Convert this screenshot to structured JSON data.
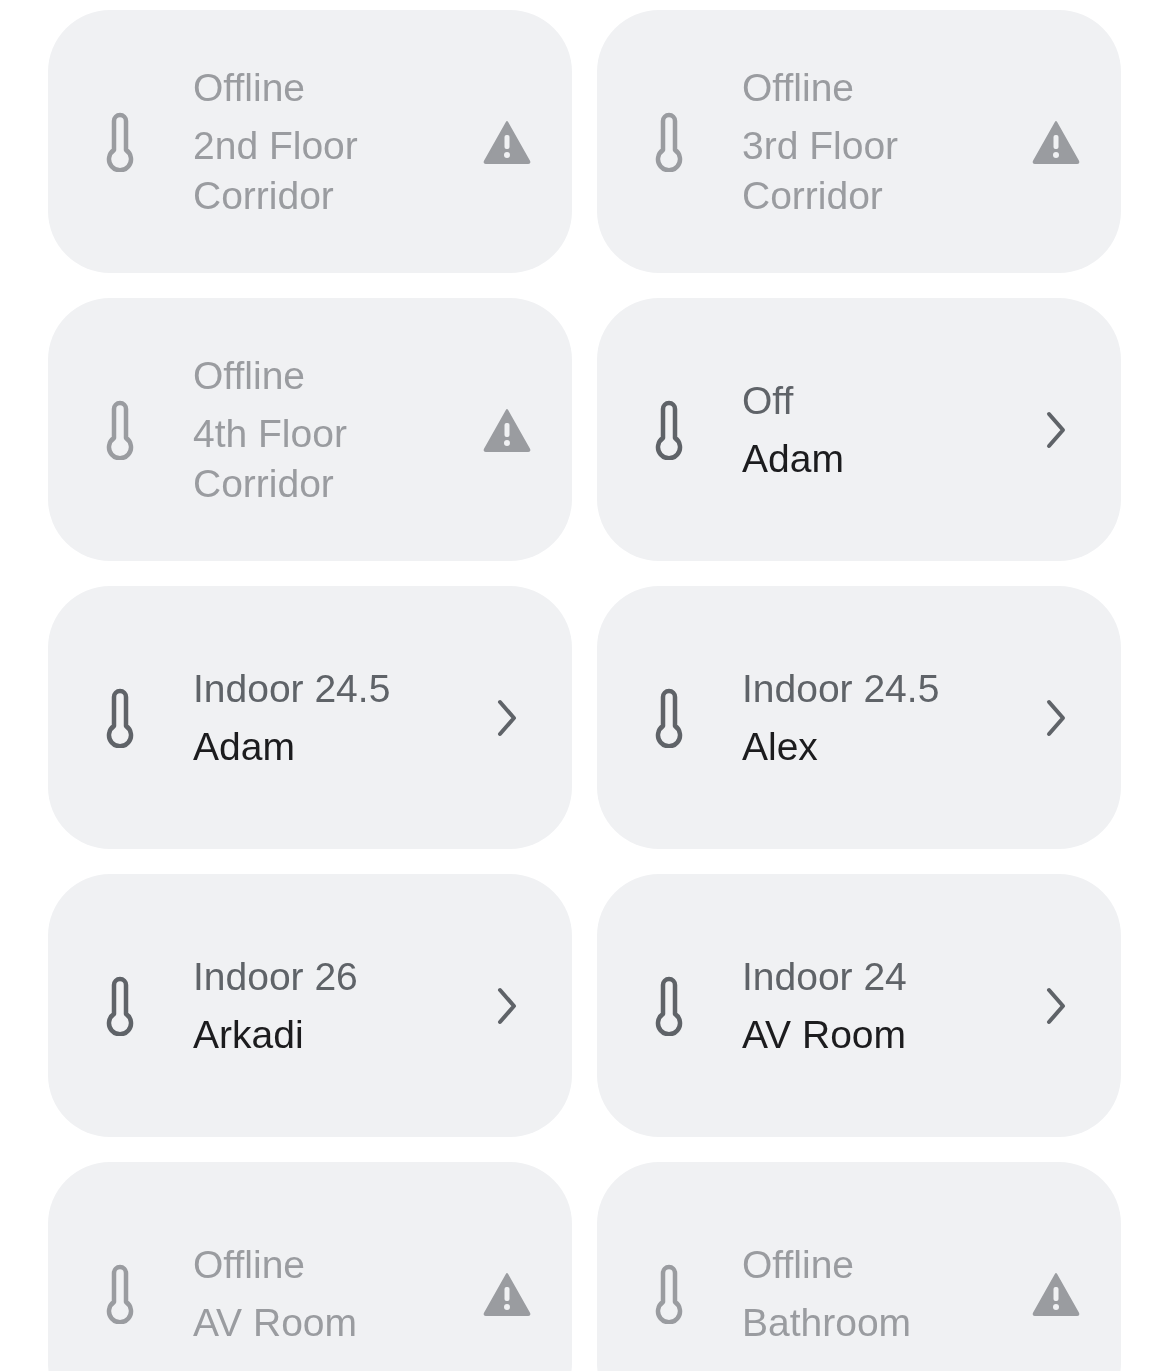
{
  "tiles": [
    {
      "status": "Offline",
      "name": "2nd Floor Corridor",
      "offline": true
    },
    {
      "status": "Offline",
      "name": "3rd Floor Corridor",
      "offline": true
    },
    {
      "status": "Offline",
      "name": "4th Floor Corridor",
      "offline": true
    },
    {
      "status": "Off",
      "name": "Adam",
      "offline": false
    },
    {
      "status": "Indoor 24.5",
      "name": "Adam",
      "offline": false
    },
    {
      "status": "Indoor 24.5",
      "name": "Alex",
      "offline": false
    },
    {
      "status": "Indoor 26",
      "name": "Arkadi",
      "offline": false
    },
    {
      "status": "Indoor 24",
      "name": "AV Room",
      "offline": false
    },
    {
      "status": "Offline",
      "name": "AV Room",
      "offline": true
    },
    {
      "status": "Offline",
      "name": "Bathroom",
      "offline": true
    }
  ]
}
